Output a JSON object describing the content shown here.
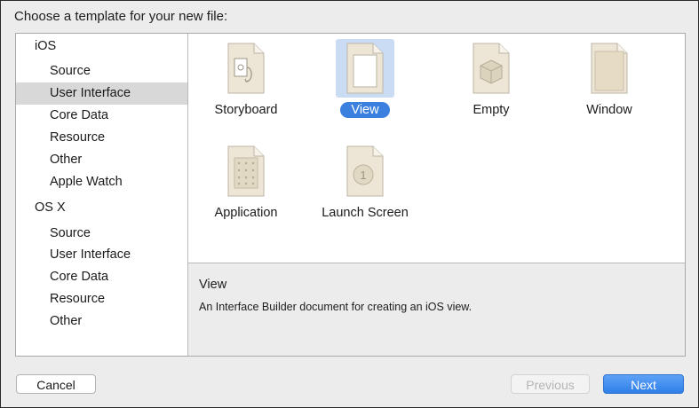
{
  "dialog": {
    "heading": "Choose a template for your new file:"
  },
  "sidebar": {
    "sections": [
      {
        "label": "iOS",
        "items": [
          {
            "label": "Source"
          },
          {
            "label": "User Interface",
            "selected": true
          },
          {
            "label": "Core Data"
          },
          {
            "label": "Resource"
          },
          {
            "label": "Other"
          },
          {
            "label": "Apple Watch"
          }
        ]
      },
      {
        "label": "OS X",
        "items": [
          {
            "label": "Source"
          },
          {
            "label": "User Interface"
          },
          {
            "label": "Core Data"
          },
          {
            "label": "Resource"
          },
          {
            "label": "Other"
          }
        ]
      }
    ]
  },
  "templates": [
    {
      "label": "Storyboard",
      "icon": "storyboard-icon"
    },
    {
      "label": "View",
      "icon": "view-icon",
      "selected": true
    },
    {
      "label": "Empty",
      "icon": "empty-icon"
    },
    {
      "label": "Window",
      "icon": "window-icon"
    },
    {
      "label": "Application",
      "icon": "application-icon"
    },
    {
      "label": "Launch Screen",
      "icon": "launch-screen-icon"
    }
  ],
  "description": {
    "title": "View",
    "body": "An Interface Builder document for creating an iOS view."
  },
  "buttons": {
    "cancel": "Cancel",
    "previous": "Previous",
    "next": "Next"
  },
  "colors": {
    "accent": "#3b80de",
    "selection_bg": "#c9dcf3",
    "sidebar_selected": "#d8d8d8",
    "document_paper": "#ede6d6"
  }
}
